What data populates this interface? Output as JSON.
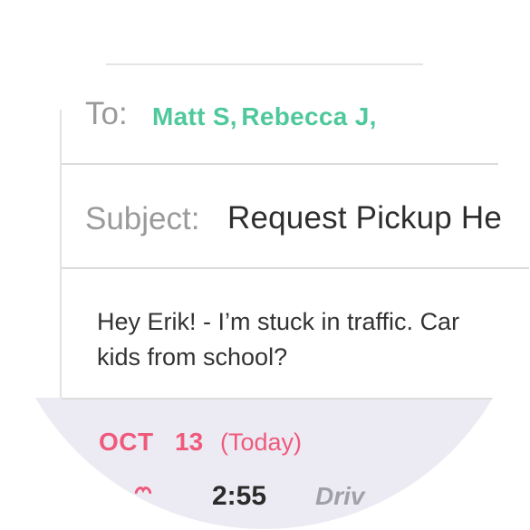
{
  "compose": {
    "to_label": "To:",
    "recipients": [
      "Matt S,",
      "Rebecca J,"
    ],
    "subject_label": "Subject:",
    "subject_value": "Request Pickup He",
    "body_lines": [
      "Hey Erik! - I’m stuck in traffic. Car",
      "kids from school?"
    ]
  },
  "schedule": {
    "month": "OCT",
    "day": "13",
    "note": "(Today)",
    "time": "2:55",
    "mode": "Driv"
  },
  "colors": {
    "recipient": "#4fc99c",
    "date": "#ef5a7c",
    "schedule_bg": "#ecebf3"
  },
  "icons": {
    "heart": "heart-icon"
  }
}
